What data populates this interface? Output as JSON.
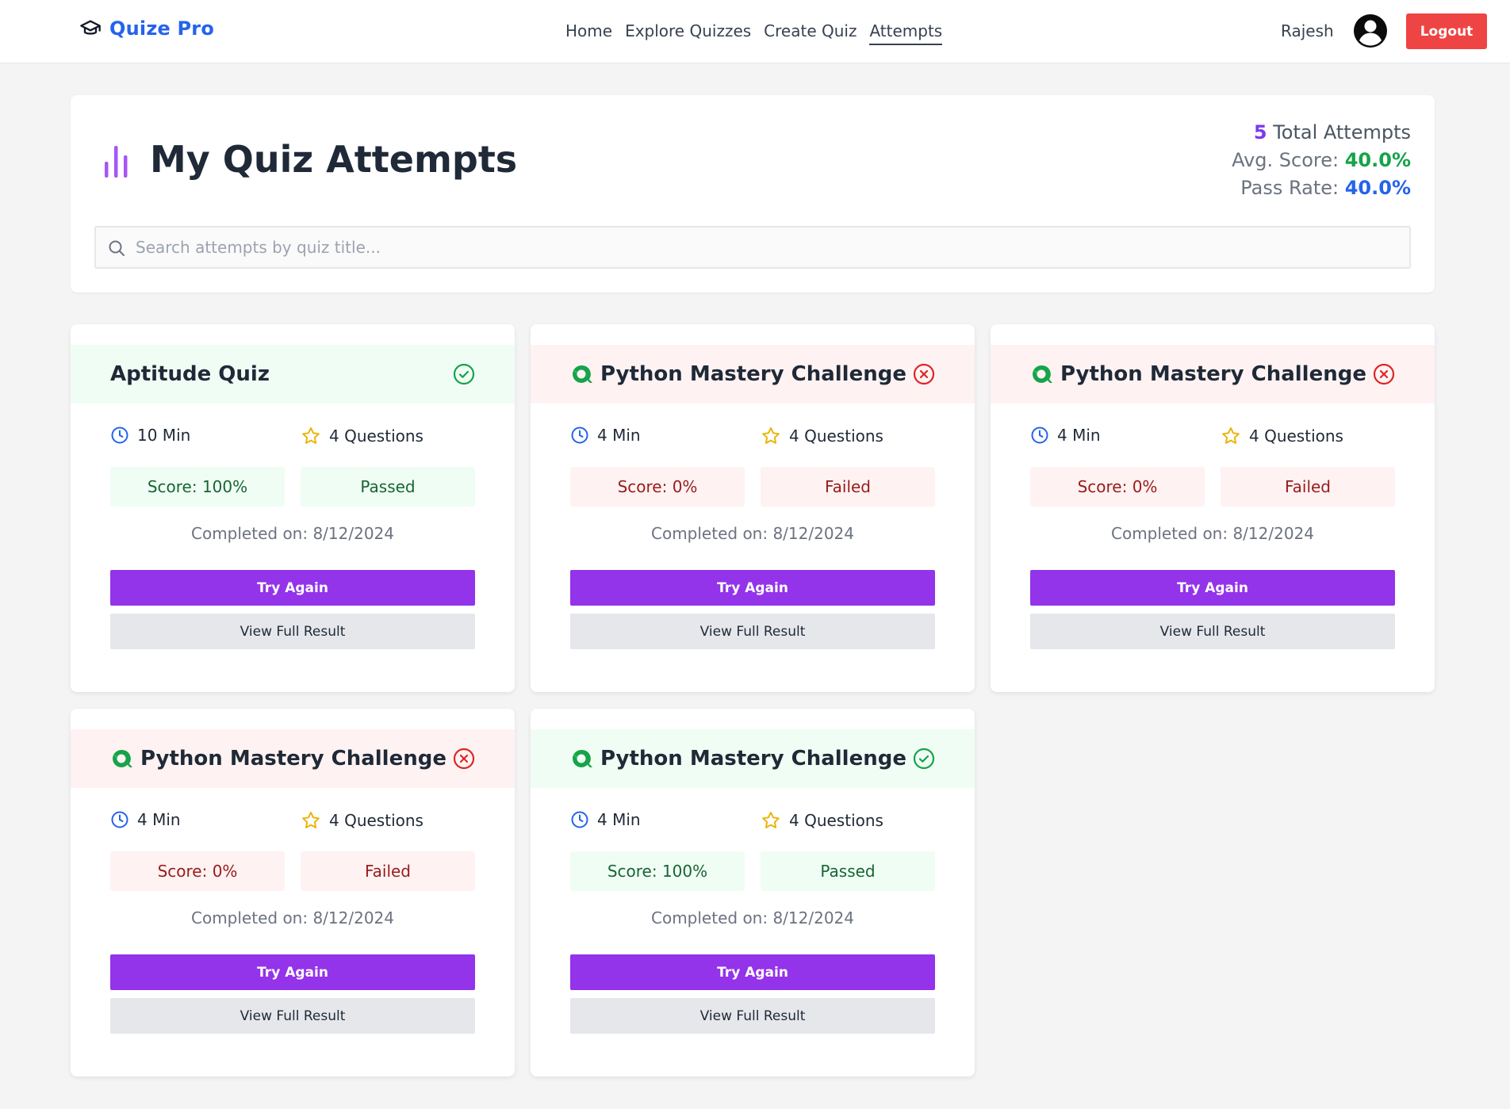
{
  "nav": {
    "brand": "Quize Pro",
    "links": [
      "Home",
      "Explore Quizzes",
      "Create Quiz",
      "Attempts"
    ],
    "active_link": "Attempts",
    "user_name": "Rajesh",
    "logout_label": "Logout"
  },
  "header": {
    "title": "My Quiz Attempts",
    "total_attempts_count": "5",
    "total_attempts_label": "Total Attempts",
    "avg_score_label": "Avg. Score:",
    "avg_score_value": "40.0%",
    "pass_rate_label": "Pass Rate:",
    "pass_rate_value": "40.0%"
  },
  "search": {
    "placeholder": "Search attempts by quiz title...",
    "value": ""
  },
  "cards": [
    {
      "title": "Aptitude Quiz",
      "has_logo": false,
      "status": "pass",
      "time": "10 Min",
      "questions": "4 Questions",
      "score": "Score: 100%",
      "result": "Passed",
      "completed": "Completed on: 8/12/2024",
      "try_label": "Try Again",
      "view_label": "View Full Result"
    },
    {
      "title": "Python Mastery Challenge",
      "has_logo": true,
      "status": "fail",
      "time": "4 Min",
      "questions": "4 Questions",
      "score": "Score: 0%",
      "result": "Failed",
      "completed": "Completed on: 8/12/2024",
      "try_label": "Try Again",
      "view_label": "View Full Result"
    },
    {
      "title": "Python Mastery Challenge",
      "has_logo": true,
      "status": "fail",
      "time": "4 Min",
      "questions": "4 Questions",
      "score": "Score: 0%",
      "result": "Failed",
      "completed": "Completed on: 8/12/2024",
      "try_label": "Try Again",
      "view_label": "View Full Result"
    },
    {
      "title": "Python Mastery Challenge",
      "has_logo": true,
      "status": "fail",
      "time": "4 Min",
      "questions": "4 Questions",
      "score": "Score: 0%",
      "result": "Failed",
      "completed": "Completed on: 8/12/2024",
      "try_label": "Try Again",
      "view_label": "View Full Result"
    },
    {
      "title": "Python Mastery Challenge",
      "has_logo": true,
      "status": "pass",
      "time": "4 Min",
      "questions": "4 Questions",
      "score": "Score: 100%",
      "result": "Passed",
      "completed": "Completed on: 8/12/2024",
      "try_label": "Try Again",
      "view_label": "View Full Result"
    }
  ],
  "colors": {
    "brand": "#2563eb",
    "logout": "#ef4444",
    "primary_button": "#9333ea",
    "pass": "#16a34a",
    "fail": "#dc2626"
  },
  "icons": {
    "brand": "graduation-cap-icon",
    "title": "bar-chart-icon",
    "search": "search-icon",
    "time": "clock-icon",
    "questions": "star-icon",
    "pass_status": "check-circle-icon",
    "fail_status": "x-circle-icon",
    "quiz_logo": "quiz-logo-icon",
    "avatar": "user-avatar-icon"
  }
}
